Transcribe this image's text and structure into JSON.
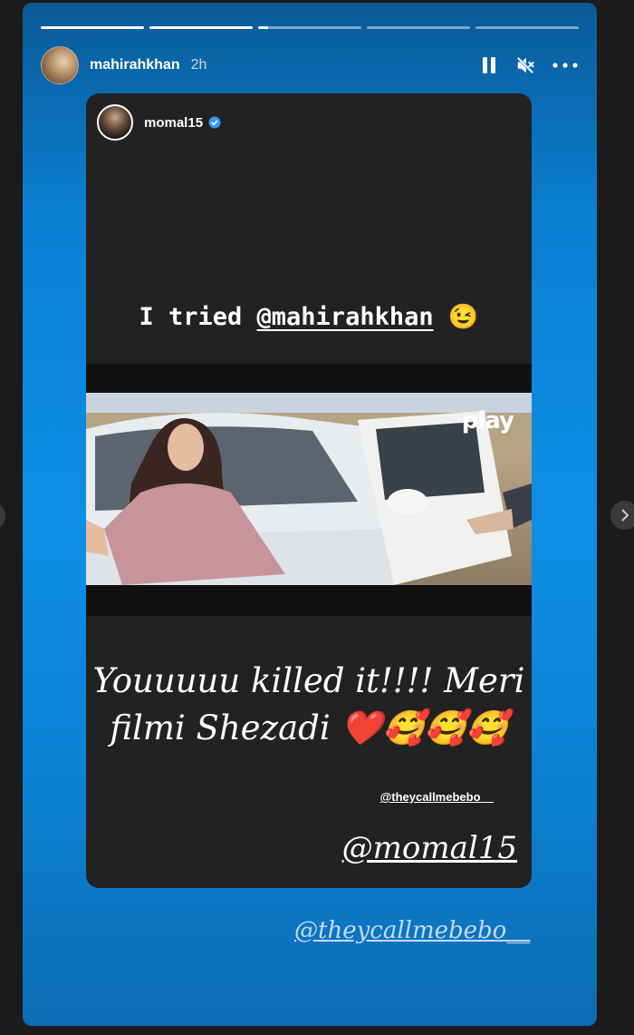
{
  "story": {
    "progress": [
      1.0,
      1.0,
      0.1,
      0.0,
      0.0
    ],
    "author": {
      "username": "mahirahkhan",
      "time": "2h",
      "avatar_icon": "profile-avatar"
    },
    "controls": {
      "pause_icon": "pause-icon",
      "mute_icon": "muted-speaker-icon",
      "more_icon": "more-horizontal-icon"
    },
    "reshare": {
      "username": "momal15",
      "verified_icon": "verified-badge-icon",
      "headline_prefix": "I tried ",
      "headline_mention": "@mahirahkhan",
      "headline_emoji": "😉",
      "video_watermark": "play",
      "caption_line1": "Youuuuu killed it!!!! Meri",
      "caption_line2": "filmi Shezadi ❤️🥰🥰🥰",
      "mention_small": "@theycallmebebo__",
      "mention_large": "@momal15"
    },
    "bottom_mention": "@theycallmebebo__"
  },
  "colors": {
    "accent_blue": "#0d8fe6",
    "card_bg": "#222222",
    "verified": "#3897f0"
  }
}
